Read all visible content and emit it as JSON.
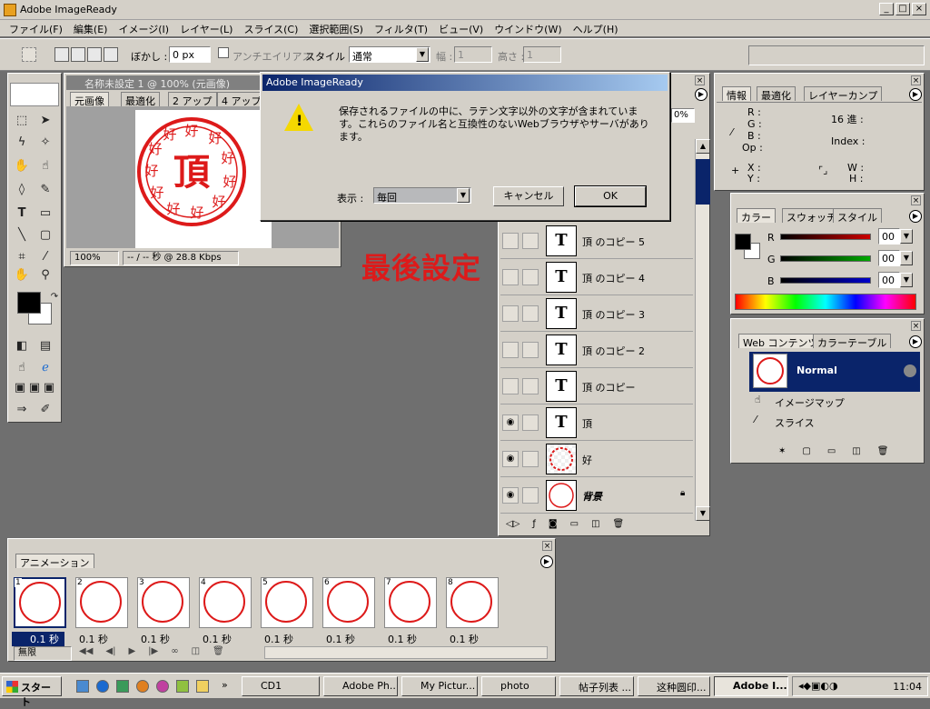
{
  "window": {
    "title": "Adobe ImageReady"
  },
  "menu": [
    "ファイル(F)",
    "編集(E)",
    "イメージ(I)",
    "レイヤー(L)",
    "スライス(C)",
    "選択範囲(S)",
    "フィルタ(T)",
    "ビュー(V)",
    "ウインドウ(W)",
    "ヘルプ(H)"
  ],
  "options": {
    "feather_label": "ぼかし :",
    "feather_value": "0 px",
    "antialias_label": "アンチエイリアス",
    "style_label": "スタイル :",
    "style_value": "通常",
    "width_label": "幅 :",
    "width_value": "1",
    "height_label": "高さ :",
    "height_value": "1"
  },
  "document": {
    "title": "名称未設定 1 @ 100% (元画像)",
    "tabs": [
      "元画像",
      "最適化",
      "2 アップ",
      "4 アップ"
    ],
    "zoom": "100%",
    "speed": "-- / -- 秒 @ 28.8 Kbps",
    "stamp_main": "頂",
    "stamp_ring": "好"
  },
  "annotation": "最後設定",
  "dialog": {
    "title": "Adobe ImageReady",
    "message": "保存されるファイルの中に、ラテン文字以外の文字が含まれています。これらのファイル名と互換性のないWebブラウザやサーバがあります。",
    "show_label": "表示 :",
    "show_value": "毎回",
    "cancel": "キャンセル",
    "ok": "OK"
  },
  "layers": [
    {
      "name": "頂 のコピー 5",
      "thumb": "T",
      "visible": false
    },
    {
      "name": "頂 のコピー 4",
      "thumb": "T",
      "visible": false
    },
    {
      "name": "頂 のコピー 3",
      "thumb": "T",
      "visible": false
    },
    {
      "name": "頂 のコピー 2",
      "thumb": "T",
      "visible": false
    },
    {
      "name": "頂 のコピー",
      "thumb": "T",
      "visible": false
    },
    {
      "name": "頂",
      "thumb": "T",
      "visible": true
    },
    {
      "name": "好",
      "thumb": "",
      "visible": true
    },
    {
      "name": "背景",
      "thumb": "",
      "visible": true
    }
  ],
  "layers_partial_tab": "0%",
  "info_panel": {
    "tabs": [
      "情報",
      "最適化",
      "レイヤーカンプ"
    ],
    "rgb": [
      "R :",
      "G :",
      "B :",
      "Op :"
    ],
    "hex_label": "16 進 :",
    "index_label": "Index :",
    "xy": [
      "X :",
      "Y :"
    ],
    "wh": [
      "W :",
      "H :"
    ]
  },
  "color_panel": {
    "tabs": [
      "カラー",
      "スウォッチ",
      "スタイル"
    ],
    "channels": [
      {
        "label": "R",
        "value": "00",
        "color": "#cc0000"
      },
      {
        "label": "G",
        "value": "00",
        "color": "#00aa00"
      },
      {
        "label": "B",
        "value": "00",
        "color": "#0000cc"
      }
    ]
  },
  "web_panel": {
    "tabs": [
      "Web コンテンツ",
      "カラーテーブル"
    ],
    "selected": "Normal",
    "items": [
      "イメージマップ",
      "スライス"
    ]
  },
  "animation": {
    "tab": "アニメーション",
    "frames": [
      {
        "num": "1",
        "delay": "0.1 秒"
      },
      {
        "num": "2",
        "delay": "0.1 秒"
      },
      {
        "num": "3",
        "delay": "0.1 秒"
      },
      {
        "num": "4",
        "delay": "0.1 秒"
      },
      {
        "num": "5",
        "delay": "0.1 秒"
      },
      {
        "num": "6",
        "delay": "0.1 秒"
      },
      {
        "num": "7",
        "delay": "0.1 秒"
      },
      {
        "num": "8",
        "delay": "0.1 秒"
      }
    ],
    "loop": "無限"
  },
  "taskbar": {
    "start": "スタート",
    "tasks": [
      "CD1",
      "Adobe Ph...",
      "My Pictur...",
      "photo",
      "帖子列表 ...",
      "这种圆印...",
      "Adobe I..."
    ],
    "time": "11:04"
  },
  "colors": {
    "accent": "#0a246a",
    "stamp_red": "#dd1a1a"
  }
}
